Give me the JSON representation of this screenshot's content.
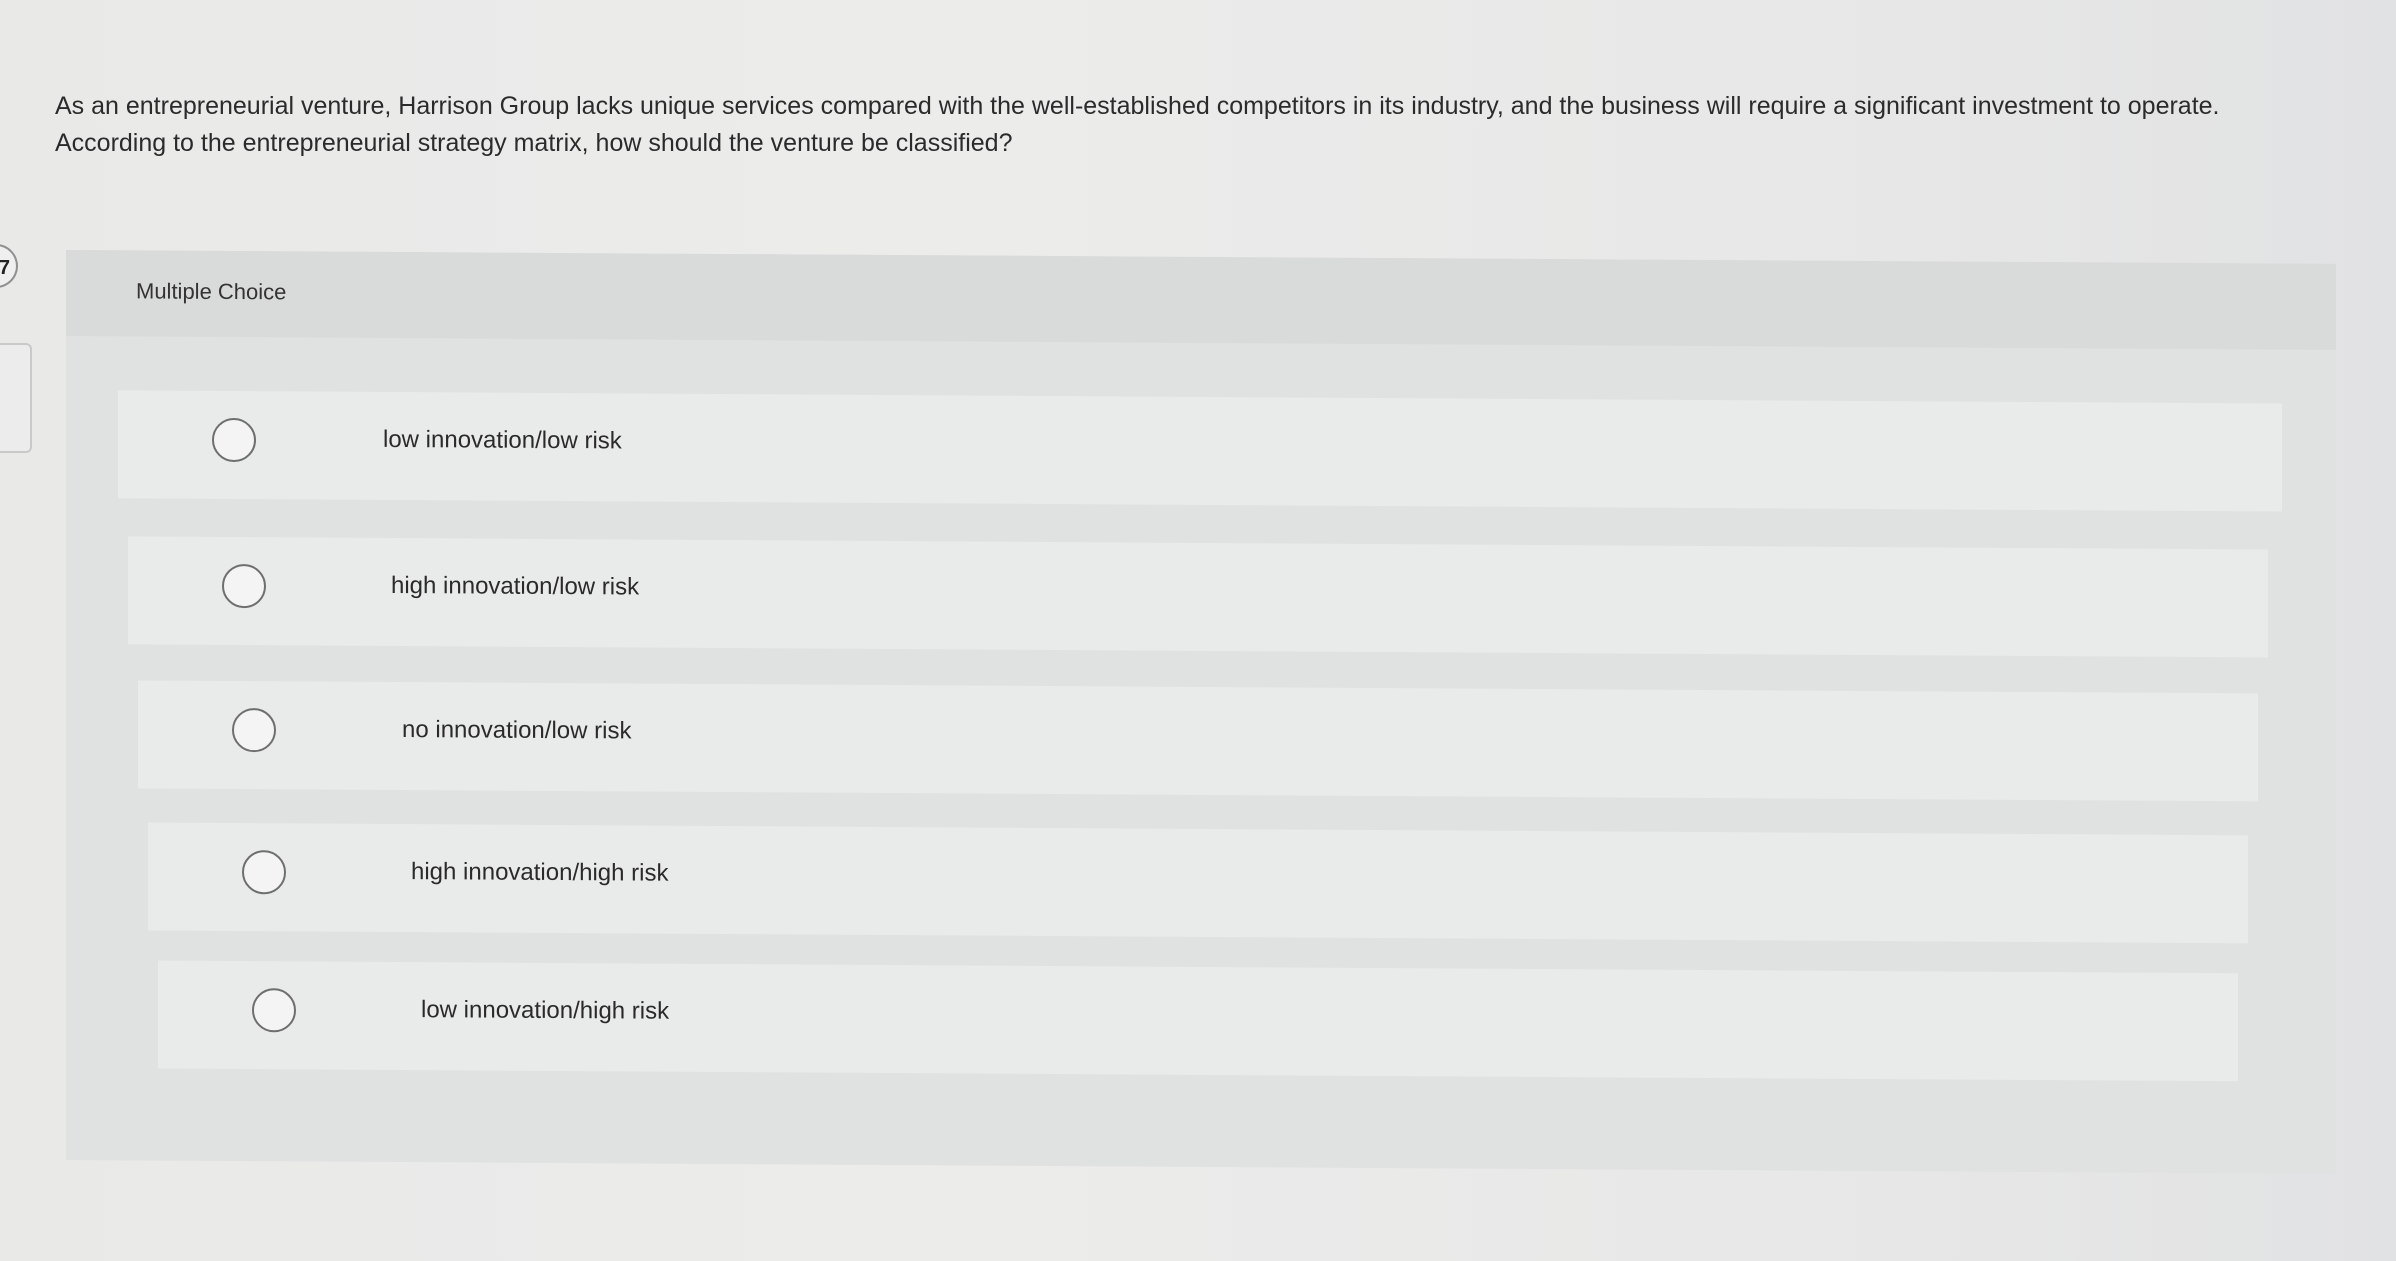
{
  "question": {
    "line1": "As an entrepreneurial venture, Harrison Group lacks unique services compared with the well-established competitors in its industry, and the business will require a significant investment to operate.",
    "line2": "According to the entrepreneurial strategy matrix, how should the venture be classified?",
    "number": "7"
  },
  "multiple_choice": {
    "header": "Multiple Choice",
    "options": [
      {
        "label": "low innovation/low risk",
        "selected": false
      },
      {
        "label": "high innovation/low risk",
        "selected": false
      },
      {
        "label": "no innovation/low risk",
        "selected": false
      },
      {
        "label": "high innovation/high risk",
        "selected": false
      },
      {
        "label": "low innovation/high risk",
        "selected": false
      }
    ]
  },
  "colors": {
    "page_background": "#ebebea",
    "panel_background": "#e0e1e1",
    "choice_background": "#e9eaea",
    "radio_border": "#6e6e6e"
  }
}
